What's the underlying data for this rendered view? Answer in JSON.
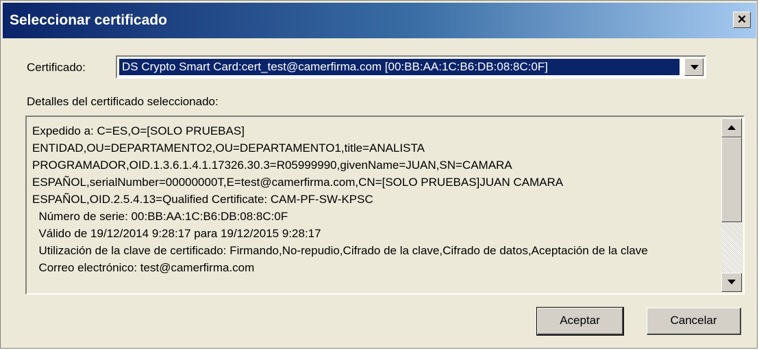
{
  "window": {
    "title": "Seleccionar certificado",
    "close_glyph": "✕"
  },
  "form": {
    "certificate_label": "Certificado:",
    "certificate_value": "DS Crypto Smart Card:cert_test@camerfirma.com [00:BB:AA:1C:B6:DB:08:8C:0F]",
    "details_label": "Detalles del certificado seleccionado:"
  },
  "details": {
    "lines": [
      "Expedido a: C=ES,O=[SOLO PRUEBAS]",
      "ENTIDAD,OU=DEPARTAMENTO2,OU=DEPARTAMENTO1,title=ANALISTA",
      "PROGRAMADOR,OID.1.3.6.1.4.1.17326.30.3=R05999990,givenName=JUAN,SN=CAMARA",
      "ESPAÑOL,serialNumber=00000000T,E=test@camerfirma.com,CN=[SOLO PRUEBAS]JUAN CAMARA",
      "ESPAÑOL,OID.2.5.4.13=Qualified Certificate: CAM-PF-SW-KPSC",
      "  Número de serie: 00:BB:AA:1C:B6:DB:08:8C:0F",
      "  Válido de 19/12/2014 9:28:17 para 19/12/2015 9:28:17",
      "  Utilización de la clave de certificado: Firmando,No-repudio,Cifrado de la clave,Cifrado de datos,Aceptación de la clave",
      "  Correo electrónico: test@camerfirma.com"
    ]
  },
  "buttons": {
    "accept": "Aceptar",
    "cancel": "Cancelar"
  },
  "colors": {
    "title_bar": "#0a246a",
    "selection": "#0a246a",
    "dialog_bg": "#ece9d8"
  },
  "icons": {
    "close": "close-icon",
    "dropdown": "chevron-down-icon",
    "scroll_up": "scroll-up-arrow-icon",
    "scroll_down": "scroll-down-arrow-icon"
  }
}
